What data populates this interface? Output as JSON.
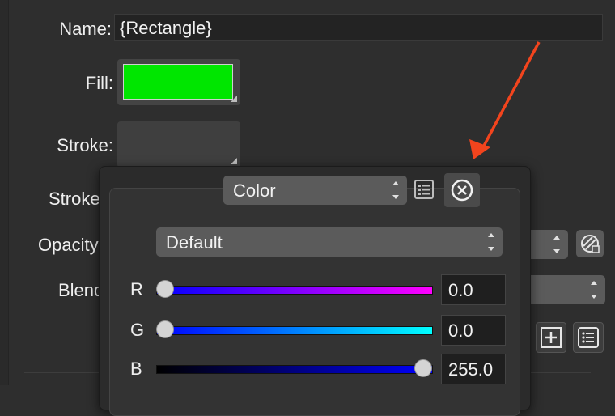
{
  "labels": {
    "name": "Name:",
    "fill": "Fill:",
    "stroke": "Stroke:",
    "stroke_width": "Stroke",
    "opacity": "Opacity",
    "blend": "Blend"
  },
  "name_value": "{Rectangle}",
  "fill_color": "#00e600",
  "popover": {
    "mode_select": "Color",
    "palette_select": "Default",
    "icons": [
      "list-icon",
      "close-circle-icon"
    ],
    "sliders": [
      {
        "label": "R",
        "value": "0.0",
        "fraction": 0.0,
        "gradient": "linear-gradient(to right,#0000ff,#ff00ff)"
      },
      {
        "label": "G",
        "value": "0.0",
        "fraction": 0.0,
        "gradient": "linear-gradient(to right,#0000ff,#00ffff)"
      },
      {
        "label": "B",
        "value": "255.0",
        "fraction": 1.0,
        "gradient": "linear-gradient(to right,#000000,#0000ff)"
      }
    ]
  },
  "annotation_arrow_color": "#f2441d",
  "right_icons": [
    "opacity-pattern-icon",
    "add-icon",
    "list-icon"
  ]
}
